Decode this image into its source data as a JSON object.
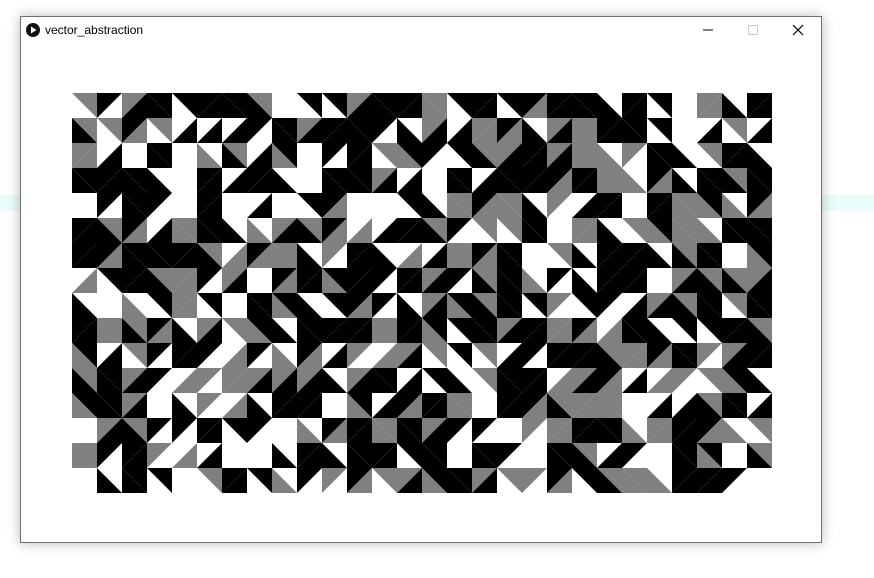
{
  "window": {
    "title": "vector_abstraction",
    "icon": "play-circle-icon",
    "controls": [
      "minimize-icon",
      "maximize-icon",
      "close-icon"
    ]
  },
  "sketch": {
    "columns": 28,
    "rows": 16,
    "colors": {
      "black": "#000000",
      "gray": "#808080",
      "white": "#ffffff"
    }
  },
  "colors": {
    "strip": "#eafcfb",
    "window_border": "#6f6f6f"
  }
}
